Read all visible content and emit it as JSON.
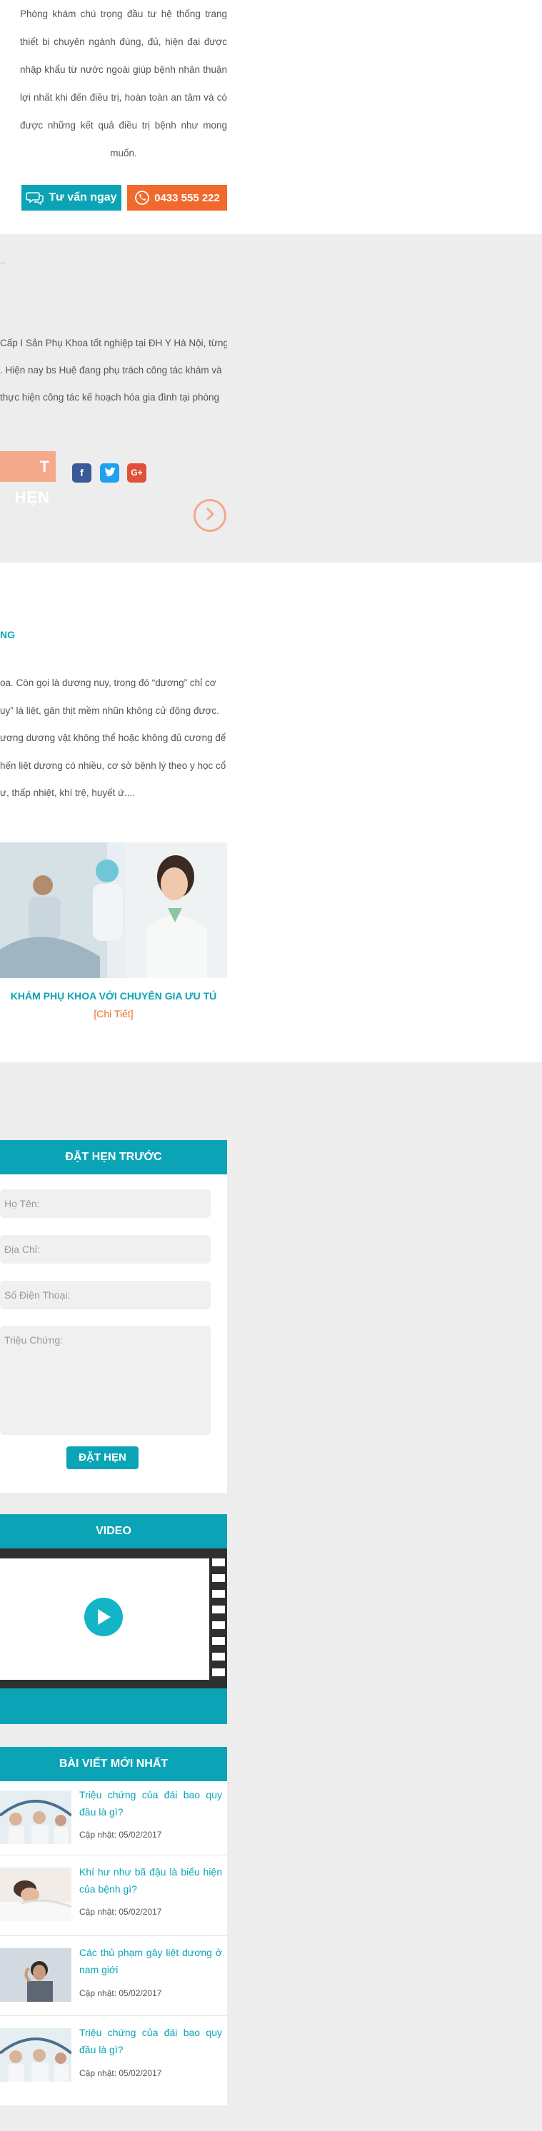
{
  "intro": {
    "text": "Phòng khám chú trọng đầu tư hệ thống trang thiết bị chuyên ngành đúng, đủ, hiện đại được nhập khẩu từ nước ngoài giúp bệnh nhân thuận lợi nhất khi đến điều trị, hoàn toàn an tâm và có được những kết quả điều trị bệnh như mong muốn."
  },
  "cta": {
    "consult_label": "Tư vấn ngay",
    "phone_label": "0433 555 222"
  },
  "doctor": {
    "dots": "..",
    "desc_lines": [
      "Cấp I Sản Phụ Khoa tốt nghiệp tại ĐH Y Hà Nội, từng",
      ". Hiện nay bs Huệ đang phụ trách công tác khám và",
      "thực hiện công tác kế hoạch hóa gia đình tại phòng"
    ],
    "book_tag": "T HẸN",
    "social": [
      "f",
      "t",
      "G+"
    ],
    "colors": {
      "facebook": "#3b5998",
      "twitter": "#1da1f2",
      "google": "#e0513b"
    }
  },
  "article": {
    "heading": "NG",
    "lines": [
      "oa. Còn gọi là dương nuy, trong đó “dương” chỉ cơ",
      "uy” là liệt, gân thịt mềm nhũn không cử động được.",
      "ương dương vật không thể hoặc không đủ cương để",
      "hến liệt dương có nhiều, cơ sở bệnh lý theo y học cổ",
      "ư, thấp nhiệt, khí trệ, huyết ứ...."
    ],
    "feature_title": "KHÁM PHỤ KHOA VỚI CHUYÊN GIA ƯU TÚ",
    "feature_link": "[Chi Tiết]"
  },
  "booking": {
    "title": "ĐẶT HẸN TRƯỚC",
    "name_placeholder": "Họ Tên:",
    "address_placeholder": "Địa Chỉ:",
    "phone_placeholder": "Số Điện Thoại:",
    "symptom_placeholder": "Triệu Chứng:",
    "submit_label": "ĐẶT HẸN"
  },
  "video": {
    "title": "VIDEO"
  },
  "latest": {
    "title": "BÀI VIẾT MỚI NHẤT",
    "posts": [
      {
        "title": "Triệu chứng của đái bao quy đầu là gì?",
        "date": "Cập nhật: 05/02/2017"
      },
      {
        "title": "Khí hư như bã đậu là biểu hiện của bệnh gì?",
        "date": "Cập nhật: 05/02/2017"
      },
      {
        "title": "Các thủ phạm gây liệt dương ở nam giới",
        "date": "Cập nhật: 05/02/2017"
      },
      {
        "title": "Triệu chứng của đái bao quy đầu là gì?",
        "date": "Cập nhật: 05/02/2017"
      }
    ]
  },
  "theme": {
    "accent": "#0ba4b6",
    "orange": "#ef6a2c",
    "peach": "#f4a98a",
    "grey_bg": "#ededed"
  }
}
